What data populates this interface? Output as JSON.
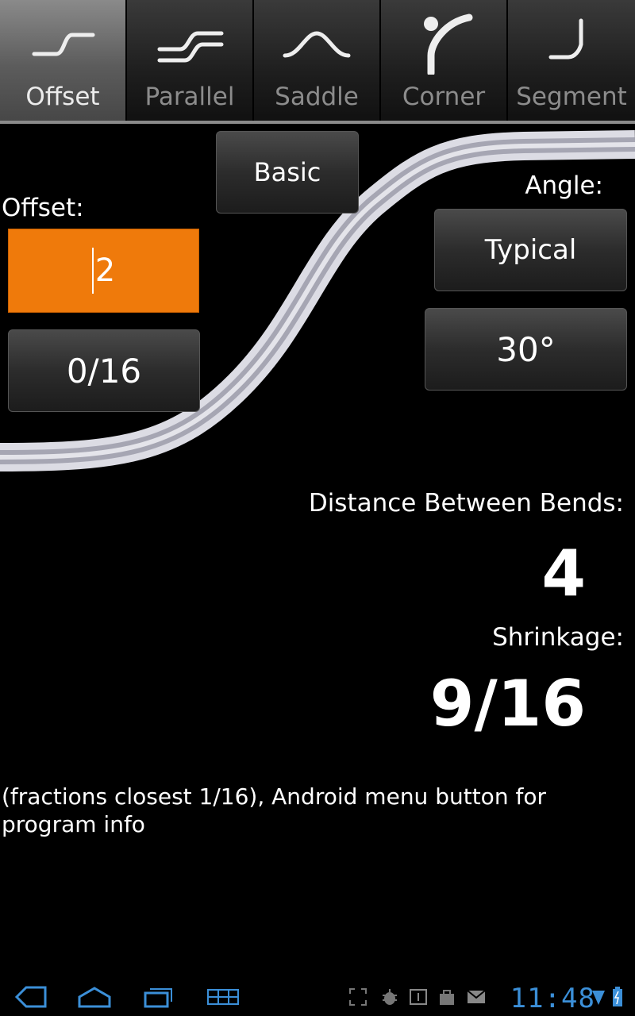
{
  "tabs": [
    {
      "label": "Offset",
      "icon": "offset-bend-icon",
      "active": true
    },
    {
      "label": "Parallel",
      "icon": "parallel-bend-icon",
      "active": false
    },
    {
      "label": "Saddle",
      "icon": "saddle-bend-icon",
      "active": false
    },
    {
      "label": "Corner",
      "icon": "corner-bend-icon",
      "active": false
    },
    {
      "label": "Segment",
      "icon": "segment-bend-icon",
      "active": false
    }
  ],
  "mode_button": "Basic",
  "offset": {
    "label": "Offset:",
    "value": "2",
    "fraction": "0/16"
  },
  "angle": {
    "label": "Angle:",
    "preset": "Typical",
    "value": "30°"
  },
  "results": {
    "distance_label": "Distance Between Bends:",
    "distance_value": "4",
    "shrinkage_label": "Shrinkage:",
    "shrinkage_value": "9/16"
  },
  "footnote": "(fractions closest 1/16), Android menu button for program info",
  "status": {
    "time": "11:48"
  },
  "colors": {
    "accent": "#ef7a0b",
    "clock": "#3b8fd8",
    "active_tab": "#5c5c5c"
  }
}
